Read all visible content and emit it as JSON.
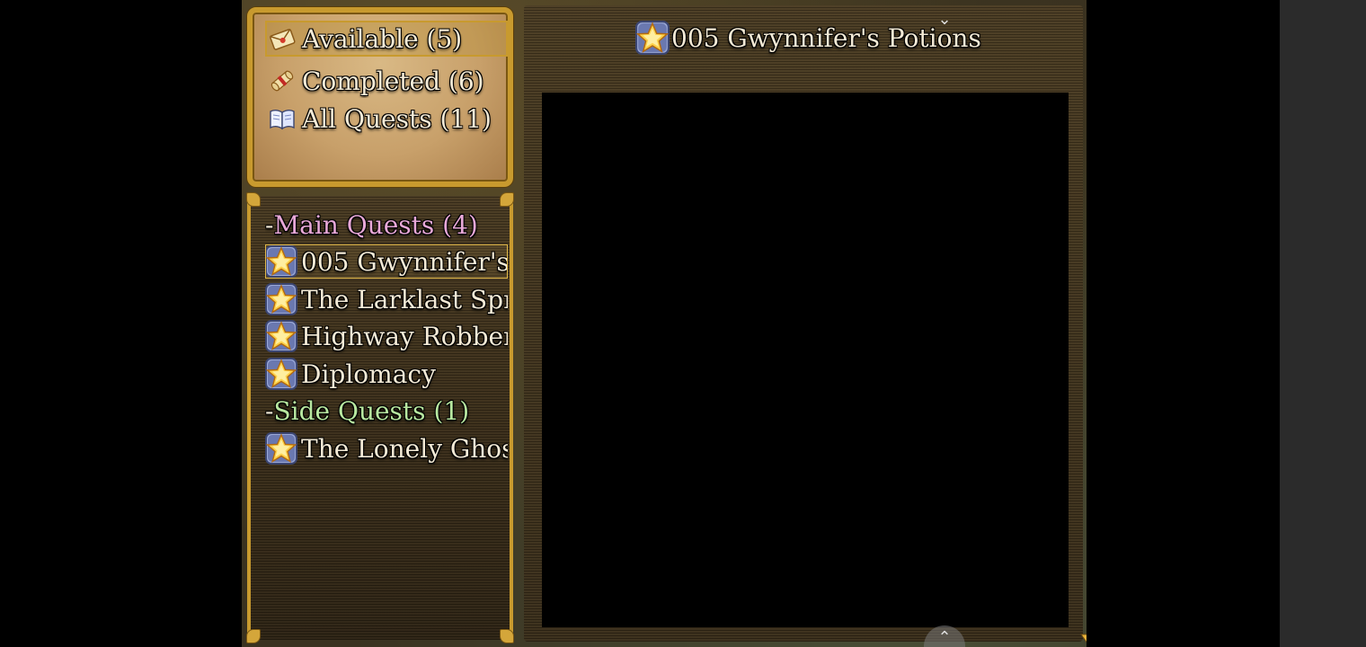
{
  "categories": [
    {
      "label": "Available (5)",
      "icon": "envelope-icon",
      "selected": true
    },
    {
      "label": "Completed (6)",
      "icon": "scroll-icon",
      "selected": false
    },
    {
      "label": "All Quests (11)",
      "icon": "book-icon",
      "selected": false
    }
  ],
  "quest_list": {
    "main_group": {
      "prefix": "-",
      "label": "Main Quests (4)"
    },
    "main_quests": [
      {
        "label": "005 Gwynnifer's",
        "icon": "star-icon",
        "selected": true
      },
      {
        "label": "The Larklast Spr",
        "icon": "star-icon",
        "selected": false
      },
      {
        "label": "Highway Robber",
        "icon": "star-icon",
        "selected": false
      },
      {
        "label": "Diplomacy",
        "icon": "star-icon",
        "selected": false
      }
    ],
    "side_group": {
      "prefix": "-",
      "label": "Side Quests (1)"
    },
    "side_quests": [
      {
        "label": "The Lonely Ghos",
        "icon": "star-icon",
        "selected": false
      }
    ]
  },
  "detail": {
    "title": "005 Gwynnifer's Potions",
    "icon": "star-icon",
    "scroll_up": "⌃",
    "scroll_down": "⌄"
  },
  "colors": {
    "main_group": "#e8a8d8",
    "side_group": "#b8e8a0",
    "frame_gold": "#c89a2e"
  }
}
